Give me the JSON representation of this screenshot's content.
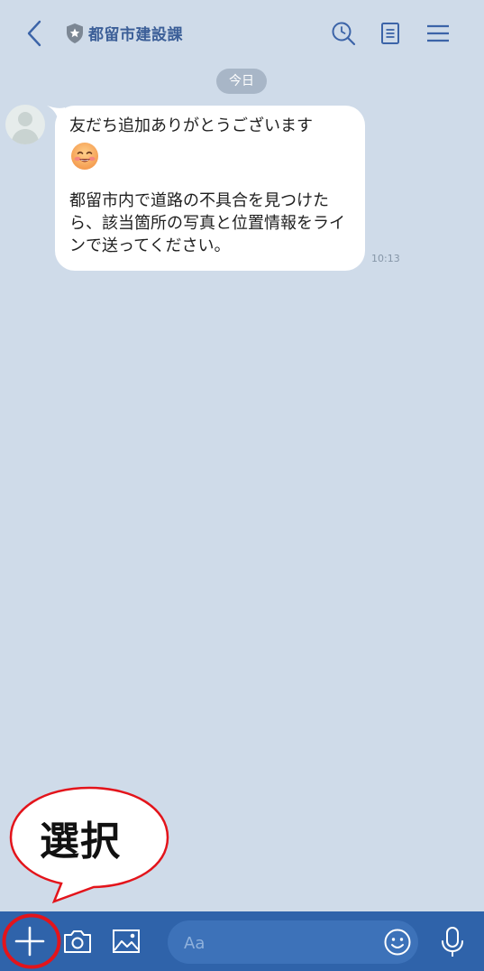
{
  "header": {
    "title": "都留市建設課",
    "icons": [
      "back-arrow",
      "shield-star-badge",
      "search-clock",
      "note",
      "hamburger-menu"
    ]
  },
  "chat": {
    "date_label": "今日",
    "messages": [
      {
        "line1": "友だち追加ありがとうございます",
        "emoji": "smiling-face",
        "body": "都留市内で道路の不具合を見つけたら、該当箇所の写真と位置情報をラインで送ってください。",
        "time": "10:13"
      }
    ]
  },
  "annotation": {
    "callout_text": "選択",
    "highlight_color": "#e3141b"
  },
  "input_bar": {
    "placeholder": "Aa",
    "icons": [
      "plus",
      "camera",
      "image",
      "emoji",
      "microphone"
    ]
  },
  "colors": {
    "background": "#cfdbe9",
    "accent": "#2f63aa",
    "title": "#3c5f98"
  }
}
